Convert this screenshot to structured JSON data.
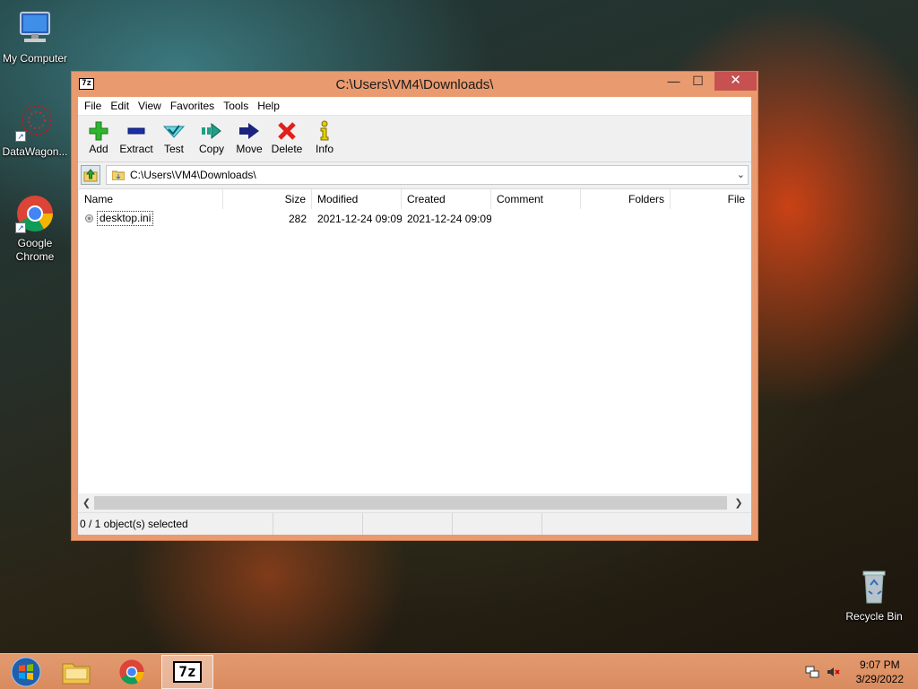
{
  "desktop": {
    "icons": [
      {
        "label": "My Computer"
      },
      {
        "label": "DataWagon..."
      },
      {
        "label": "Google Chrome"
      },
      {
        "label": "Recycle Bin"
      }
    ]
  },
  "window": {
    "title": "C:\\Users\\VM4\\Downloads\\",
    "app_icon": "7z",
    "controls": {
      "minimize": "—",
      "maximize": "☐",
      "close": "✕"
    }
  },
  "menu": [
    "File",
    "Edit",
    "View",
    "Favorites",
    "Tools",
    "Help"
  ],
  "toolbar": [
    {
      "label": "Add",
      "icon": "plus-icon",
      "color": "#2fb52f"
    },
    {
      "label": "Extract",
      "icon": "minus-icon",
      "color": "#1a2fa8"
    },
    {
      "label": "Test",
      "icon": "check-icon",
      "color": "#2ab8c8"
    },
    {
      "label": "Copy",
      "icon": "copy-arrow-icon",
      "color": "#1f9e88"
    },
    {
      "label": "Move",
      "icon": "move-arrow-icon",
      "color": "#1a237e"
    },
    {
      "label": "Delete",
      "icon": "delete-x-icon",
      "color": "#e0201c"
    },
    {
      "label": "Info",
      "icon": "info-icon",
      "color": "#c8b400"
    }
  ],
  "address": {
    "path": "C:\\Users\\VM4\\Downloads\\"
  },
  "columns": [
    "Name",
    "Size",
    "Modified",
    "Created",
    "Comment",
    "Folders",
    "File"
  ],
  "files": [
    {
      "name": "desktop.ini",
      "size": "282",
      "modified": "2021-12-24 09:09",
      "created": "2021-12-24 09:09"
    }
  ],
  "status": {
    "selection": "0 / 1 object(s) selected"
  },
  "taskbar": {
    "time": "9:07 PM",
    "date": "3/29/2022"
  }
}
